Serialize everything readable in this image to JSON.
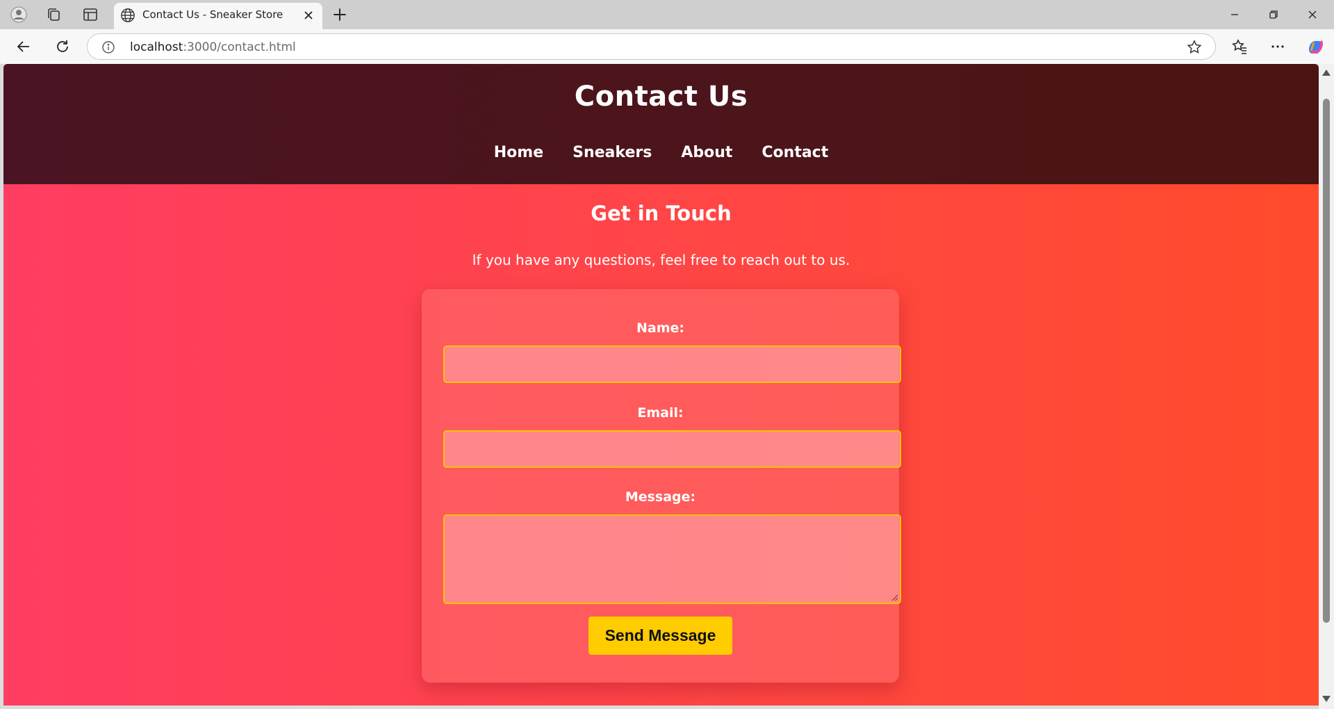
{
  "browser": {
    "tab_title": "Contact Us - Sneaker Store",
    "url_host": "localhost",
    "url_path": ":3000/contact.html",
    "icons": [
      "profile-icon",
      "collections-icon",
      "vertical-tabs-icon",
      "globe-icon",
      "close-icon",
      "new-tab-icon",
      "minimize-icon",
      "restore-icon",
      "window-close-icon",
      "back-icon",
      "refresh-icon",
      "info-icon",
      "favorite-star-icon",
      "favorites-icon",
      "more-icon",
      "copilot-icon"
    ]
  },
  "header": {
    "title": "Contact Us",
    "nav": [
      "Home",
      "Sneakers",
      "About",
      "Contact"
    ]
  },
  "main": {
    "heading": "Get in Touch",
    "subtext": "If you have any questions, feel free to reach out to us."
  },
  "form": {
    "name_label": "Name:",
    "name_value": "",
    "email_label": "Email:",
    "email_value": "",
    "message_label": "Message:",
    "message_value": "",
    "submit_label": "Send Message"
  },
  "colors": {
    "header_bg": "#4a1520",
    "page_gradient_start": "#ff3d62",
    "page_gradient_end": "#ff4b2b",
    "button_bg": "#ffcc00",
    "input_border": "#ffc400"
  }
}
